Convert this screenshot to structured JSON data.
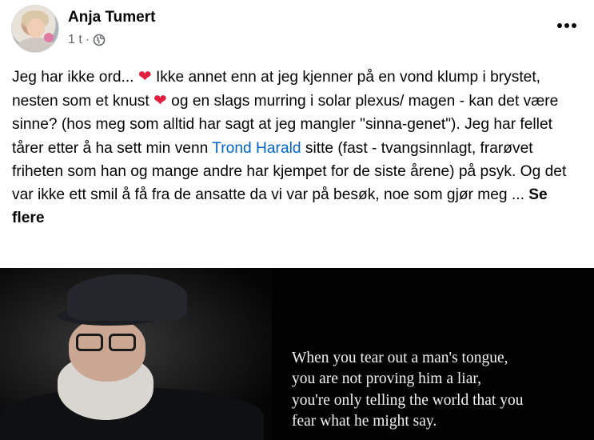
{
  "post": {
    "author": "Anja Tumert",
    "time": "1 t",
    "separator": "·",
    "privacy_icon": "globe-icon",
    "more_icon": "more-horizontal-icon",
    "text_1": "Jeg har ikke ord... ",
    "heart_1": "❤",
    "text_2": " Ikke annet enn at jeg kjenner på en vond klump i brystet, nesten som et knust ",
    "heart_2": "❤",
    "text_3": " og en slags murring i solar plexus/ magen - kan det være sinne? (hos meg som alltid har sagt at jeg mangler \"sinna-genet\"). Jeg har fellet tårer etter å ha sett min venn ",
    "mention": "Trond Harald",
    "text_4": " sitte (fast - tvangsinnlagt, frarøvet friheten som han og mange andre har kjempet for de siste årene) på psyk. Og det var ikke ett smil å få fra de ansatte da vi var på besøk, noe som gjør meg ... ",
    "see_more": "Se flere"
  },
  "image": {
    "quote_lines": [
      "When you tear out a man's tongue,",
      "you are not proving him a liar,",
      "you're only telling the world that you",
      "fear what he might say."
    ]
  },
  "colors": {
    "link": "#0064d1",
    "heart": "#e41e3f",
    "secondary_text": "#65676b"
  }
}
